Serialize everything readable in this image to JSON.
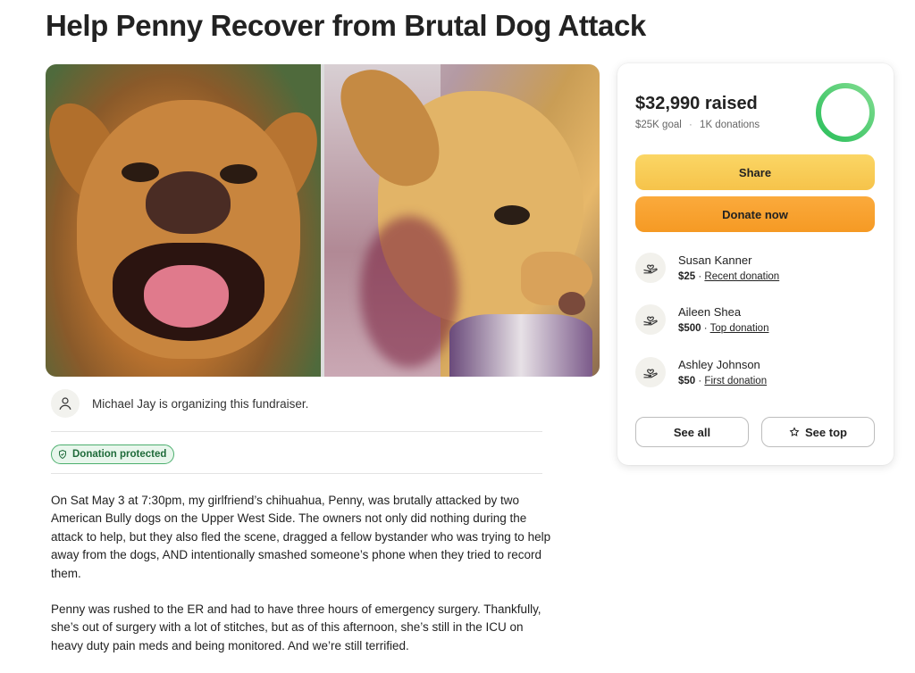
{
  "page": {
    "title": "Help Penny Recover from Brutal Dog Attack"
  },
  "organizer": {
    "text": "Michael Jay is organizing this fundraiser."
  },
  "badge": {
    "label": "Donation protected"
  },
  "story": {
    "paragraphs": [
      "On Sat May 3 at 7:30pm, my girlfriend’s chihuahua, Penny, was brutally attacked by two American Bully dogs on the Upper West Side. The owners not only did nothing during the attack to help, but they also fled the scene, dragged a fellow bystander who was trying to help away from the dogs, AND intentionally smashed someone’s phone when they tried to record them.",
      "Penny was rushed to the ER and had to have three hours of emergency surgery. Thankfully, she’s out of surgery with a lot of stitches, but as of this afternoon, she’s still in the ICU on heavy duty pain meds and being monitored. And we’re still terrified."
    ]
  },
  "card": {
    "raised": "$32,990 raised",
    "goal": "$25K goal",
    "donations": "1K donations",
    "goal_progress": 1.0,
    "ring_color": "#2ecc71",
    "share_label": "Share",
    "donate_label": "Donate now",
    "donors": [
      {
        "name": "Susan Kanner",
        "amount": "$25",
        "tag": "Recent donation"
      },
      {
        "name": "Aileen Shea",
        "amount": "$500",
        "tag": "Top donation"
      },
      {
        "name": "Ashley Johnson",
        "amount": "$50",
        "tag": "First donation"
      }
    ],
    "see_all_label": "See all",
    "see_top_label": "See top"
  },
  "colors": {
    "share": "#f6c84f",
    "donate": "#f7a030",
    "badge": "#4caf6e"
  }
}
